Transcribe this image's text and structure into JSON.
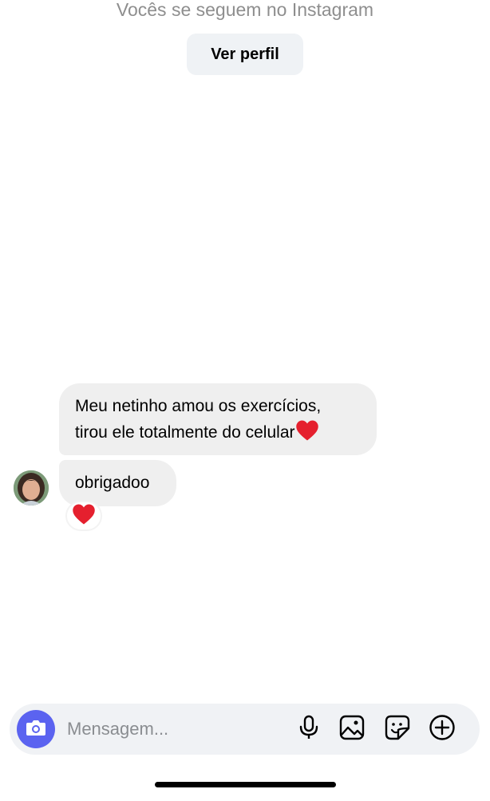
{
  "header": {
    "follow_note": "Vocês se seguem no Instagram",
    "view_profile_label": "Ver perfil"
  },
  "messages": [
    {
      "line1": "Meu netinho amou os exercícios,",
      "line2": "tirou ele totalmente do celular",
      "emoji": "heart"
    },
    {
      "text": "obrigadoo",
      "reaction": "heart"
    }
  ],
  "composer": {
    "placeholder": "Mensagem...",
    "icons": [
      "camera-icon",
      "microphone-icon",
      "gallery-icon",
      "sticker-icon",
      "plus-icon"
    ]
  },
  "colors": {
    "accent": "#5b63f0",
    "bubble": "#efefef",
    "heart": "#e5202e",
    "muted_text": "#8e8e8e"
  }
}
